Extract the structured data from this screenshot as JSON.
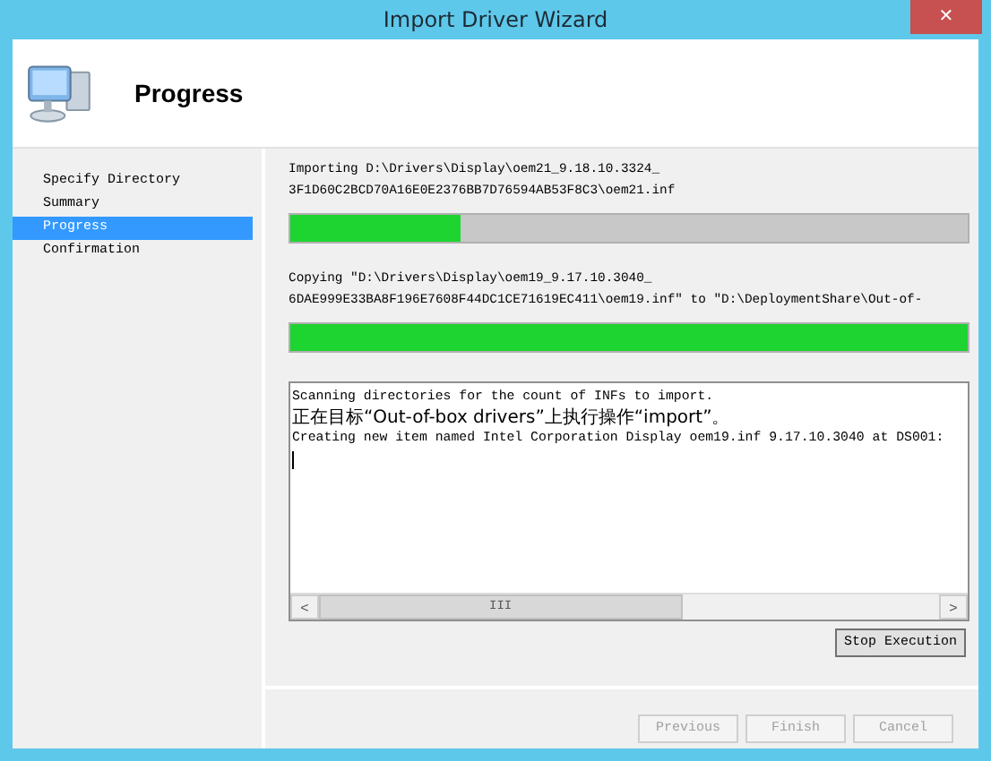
{
  "window": {
    "title": "Import Driver Wizard",
    "close": "✕"
  },
  "header": {
    "title": "Progress"
  },
  "sidebar": {
    "items": [
      {
        "label": "Specify Directory",
        "selected": false
      },
      {
        "label": "Summary",
        "selected": false
      },
      {
        "label": "Progress",
        "selected": true
      },
      {
        "label": "Confirmation",
        "selected": false
      }
    ]
  },
  "tasks": [
    {
      "lines": [
        "Importing D:\\Drivers\\Display\\oem21_9.18.10.3324_",
        "3F1D60C2BCD70A16E0E2376BB7D76594AB53F8C3\\oem21.inf"
      ],
      "level": 0.25
    },
    {
      "lines": [
        "Copying \"D:\\Drivers\\Display\\oem19_9.17.10.3040_",
        "6DAE999E33BA8F196E7608F44DC1CE71619EC411\\oem19.inf\" to \"D:\\DeploymentShare\\Out-of-"
      ],
      "level": 1
    }
  ],
  "log": {
    "lines": [
      {
        "text": "Scanning directories for the count of INFs to import.",
        "kind": "plain"
      },
      {
        "text": "正在目标“Out-of-box drivers”上执行操作“import”。",
        "kind": "cjk"
      },
      {
        "text": "Creating new item named Intel Corporation Display oem19.inf 9.17.10.3040 at DS001:",
        "kind": "plain"
      }
    ],
    "scroll_left": "<",
    "scroll_right": ">",
    "scroll_grip": "III"
  },
  "stop_button": "Stop Execution",
  "buttons": [
    {
      "label": "Previous",
      "disabled": true
    },
    {
      "label": "Finish",
      "disabled": true
    },
    {
      "label": "Cancel",
      "disabled": true
    }
  ]
}
